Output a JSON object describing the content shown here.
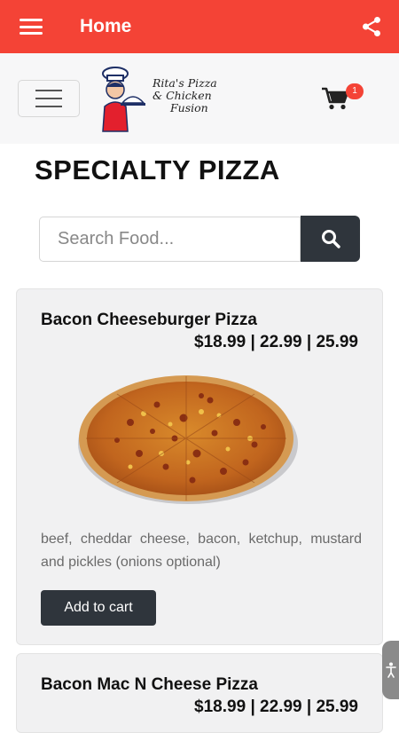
{
  "appbar": {
    "title": "Home",
    "menu_icon": "hamburger-icon",
    "share_icon": "share-icon",
    "color": "#f44336"
  },
  "site_header": {
    "logo_text_line1": "Rita's Pizza",
    "logo_text_line2": "& Chicken",
    "logo_text_line3": "Fusion",
    "cart_icon": "cart-icon",
    "cart_count": "1"
  },
  "section": {
    "title": "SPECIALTY PIZZA"
  },
  "search": {
    "placeholder": "Search Food...",
    "value": "",
    "button_icon": "search-icon"
  },
  "products": [
    {
      "name": "Bacon Cheeseburger Pizza",
      "price": "$18.99 | 22.99 | 25.99",
      "description": "beef, cheddar cheese, bacon, ketchup, mustard and pickles (onions optional)",
      "add_label": "Add to cart"
    },
    {
      "name": "Bacon Mac N Cheese Pizza",
      "price": "$18.99 | 22.99 | 25.99"
    }
  ],
  "accessibility": {
    "icon": "accessibility-icon"
  }
}
